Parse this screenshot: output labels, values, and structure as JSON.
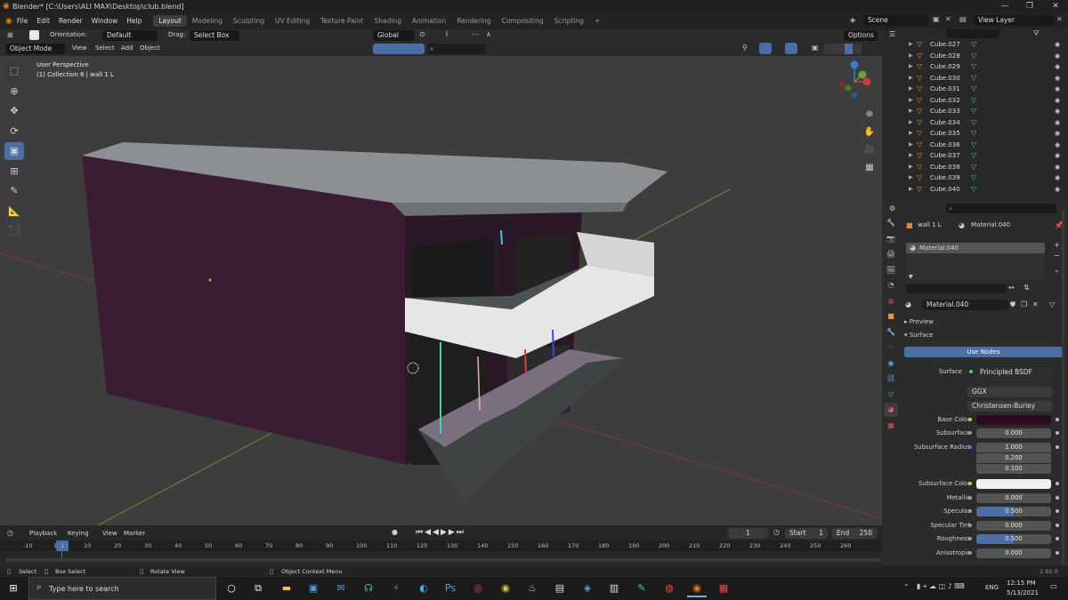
{
  "window": {
    "title": "Blender* [C:\\Users\\ALI MAX\\Desktop\\club.blend]",
    "min": "—",
    "max": "❐",
    "close": "✕"
  },
  "topbar": {
    "menus": [
      "File",
      "Edit",
      "Render",
      "Window",
      "Help"
    ],
    "workspaces": [
      "Layout",
      "Modeling",
      "Sculpting",
      "UV Editing",
      "Texture Paint",
      "Shading",
      "Animation",
      "Rendering",
      "Compositing",
      "Scripting"
    ],
    "active_workspace": "Layout",
    "add": "+",
    "scene": "Scene",
    "view_layer": "View Layer"
  },
  "header1": {
    "orientation_label": "Orientation:",
    "orientation_value": "Default",
    "drag_label": "Drag:",
    "drag_value": "Select Box",
    "transform": "Global",
    "options": "Options"
  },
  "header2": {
    "mode": "Object Mode",
    "menus": [
      "View",
      "Select",
      "Add",
      "Object"
    ]
  },
  "viewport": {
    "view_name": "User Perspective",
    "collection_info": "(1) Collection 8 | wall 1 L"
  },
  "gizmo": {
    "x": "X",
    "y": "Y",
    "z": "Z"
  },
  "outliner": {
    "items": [
      "Cube.027",
      "Cube.028",
      "Cube.029",
      "Cube.030",
      "Cube.031",
      "Cube.032",
      "Cube.033",
      "Cube.034",
      "Cube.035",
      "Cube.036",
      "Cube.037",
      "Cube.038",
      "Cube.039",
      "Cube.040"
    ]
  },
  "properties": {
    "object_name": "wall 1 L",
    "material_slot": "Material.040",
    "material_name": "Material.040",
    "panels": {
      "preview": "Preview",
      "surface": "Surface"
    },
    "use_nodes": "Use Nodes",
    "surface_label": "Surface",
    "surface_value": "Principled BSDF",
    "distribution": "GGX",
    "subsurface_method": "Christensen-Burley",
    "fields": [
      {
        "label": "Subsurface",
        "value": "0.000"
      },
      {
        "label": "Metallic",
        "value": "0.000"
      },
      {
        "label": "Specular",
        "value": "0.500"
      },
      {
        "label": "Specular Tint",
        "value": "0.000"
      },
      {
        "label": "Roughness",
        "value": "0.500"
      },
      {
        "label": "Anisotropic",
        "value": "0.000"
      }
    ],
    "base_color_label": "Base Color",
    "base_color": "#2a0a1f",
    "subsurface_radius_label": "Subsurface Radius",
    "subsurface_radius": [
      "1.000",
      "0.200",
      "0.100"
    ],
    "subsurface_color_label": "Subsurface Color",
    "subsurface_color": "#f0f0f0"
  },
  "timeline": {
    "menus": [
      "Playback",
      "Keying",
      "View",
      "Marker"
    ],
    "current_frame": "1",
    "start_label": "Start",
    "start": "1",
    "end_label": "End",
    "end": "250",
    "ticks": [
      "-10",
      "1",
      "10",
      "20",
      "30",
      "40",
      "50",
      "60",
      "70",
      "80",
      "90",
      "100",
      "110",
      "120",
      "130",
      "140",
      "150",
      "160",
      "170",
      "180",
      "190",
      "200",
      "210",
      "220",
      "230",
      "240",
      "250",
      "260"
    ]
  },
  "status": {
    "select": "Select",
    "box_select": "Box Select",
    "rotate_view": "Rotate View",
    "context_menu": "Object Context Menu",
    "version": "2.92.0"
  },
  "taskbar": {
    "search_placeholder": "Type here to search",
    "lang": "ENG",
    "time": "12:15 PM",
    "date": "5/13/2021"
  },
  "colors": {
    "accent": "#4b6fa5",
    "viewport": "#3d3d3d",
    "wall": "#3a1d33",
    "roof": "#8c8f94",
    "balcony": "#e6e6e6"
  }
}
